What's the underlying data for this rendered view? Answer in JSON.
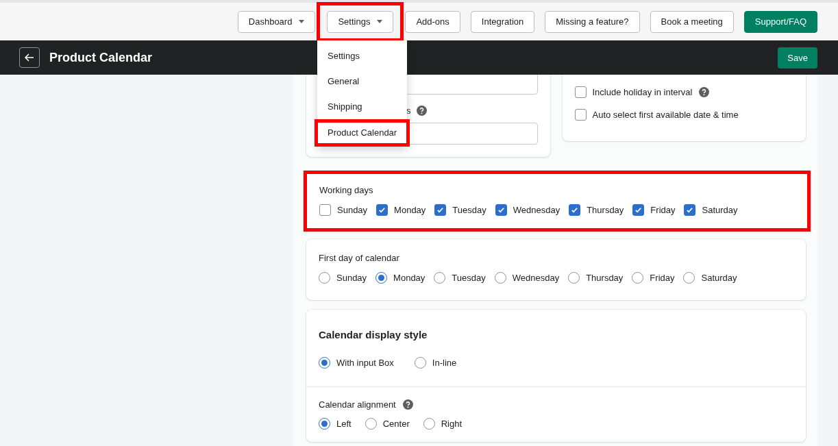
{
  "nav": [
    {
      "label": "Dashboard",
      "dropdown": true,
      "kind": "plain"
    },
    {
      "label": "Settings",
      "dropdown": true,
      "highlighted": true,
      "kind": "plain"
    },
    {
      "label": "Add-ons",
      "dropdown": false,
      "kind": "plain"
    },
    {
      "label": "Integration",
      "dropdown": false,
      "kind": "plain"
    },
    {
      "label": "Missing a feature?",
      "dropdown": false,
      "kind": "plain"
    },
    {
      "label": "Book a meeting",
      "dropdown": false,
      "kind": "plain"
    },
    {
      "label": "Support/FAQ",
      "dropdown": false,
      "kind": "primary"
    }
  ],
  "settings_menu": [
    {
      "label": "Settings",
      "highlighted": false
    },
    {
      "label": "General",
      "highlighted": false
    },
    {
      "label": "Shipping",
      "highlighted": false
    },
    {
      "label": "Product Calendar",
      "highlighted": true
    }
  ],
  "header": {
    "title": "Product Calendar",
    "save": "Save"
  },
  "left_card": {
    "label_fragment": "s"
  },
  "right_card": {
    "options": [
      {
        "label": "Include holiday in interval",
        "checked": false,
        "help": true
      },
      {
        "label": "Auto select first available date & time",
        "checked": false,
        "help": false
      }
    ]
  },
  "working_days": {
    "title": "Working days",
    "highlighted": true,
    "days": [
      {
        "label": "Sunday",
        "checked": false
      },
      {
        "label": "Monday",
        "checked": true
      },
      {
        "label": "Tuesday",
        "checked": true
      },
      {
        "label": "Wednesday",
        "checked": true
      },
      {
        "label": "Thursday",
        "checked": true
      },
      {
        "label": "Friday",
        "checked": true
      },
      {
        "label": "Saturday",
        "checked": true
      }
    ]
  },
  "first_day": {
    "title": "First day of calendar",
    "options": [
      {
        "label": "Sunday",
        "selected": false
      },
      {
        "label": "Monday",
        "selected": true
      },
      {
        "label": "Tuesday",
        "selected": false
      },
      {
        "label": "Wednesday",
        "selected": false
      },
      {
        "label": "Thursday",
        "selected": false
      },
      {
        "label": "Friday",
        "selected": false
      },
      {
        "label": "Saturday",
        "selected": false
      }
    ]
  },
  "display_style": {
    "title": "Calendar display style",
    "options": [
      {
        "label": "With input Box",
        "selected": true
      },
      {
        "label": "In-line",
        "selected": false
      }
    ]
  },
  "alignment": {
    "title": "Calendar alignment",
    "options": [
      {
        "label": "Left",
        "selected": true
      },
      {
        "label": "Center",
        "selected": false
      },
      {
        "label": "Right",
        "selected": false
      }
    ]
  }
}
